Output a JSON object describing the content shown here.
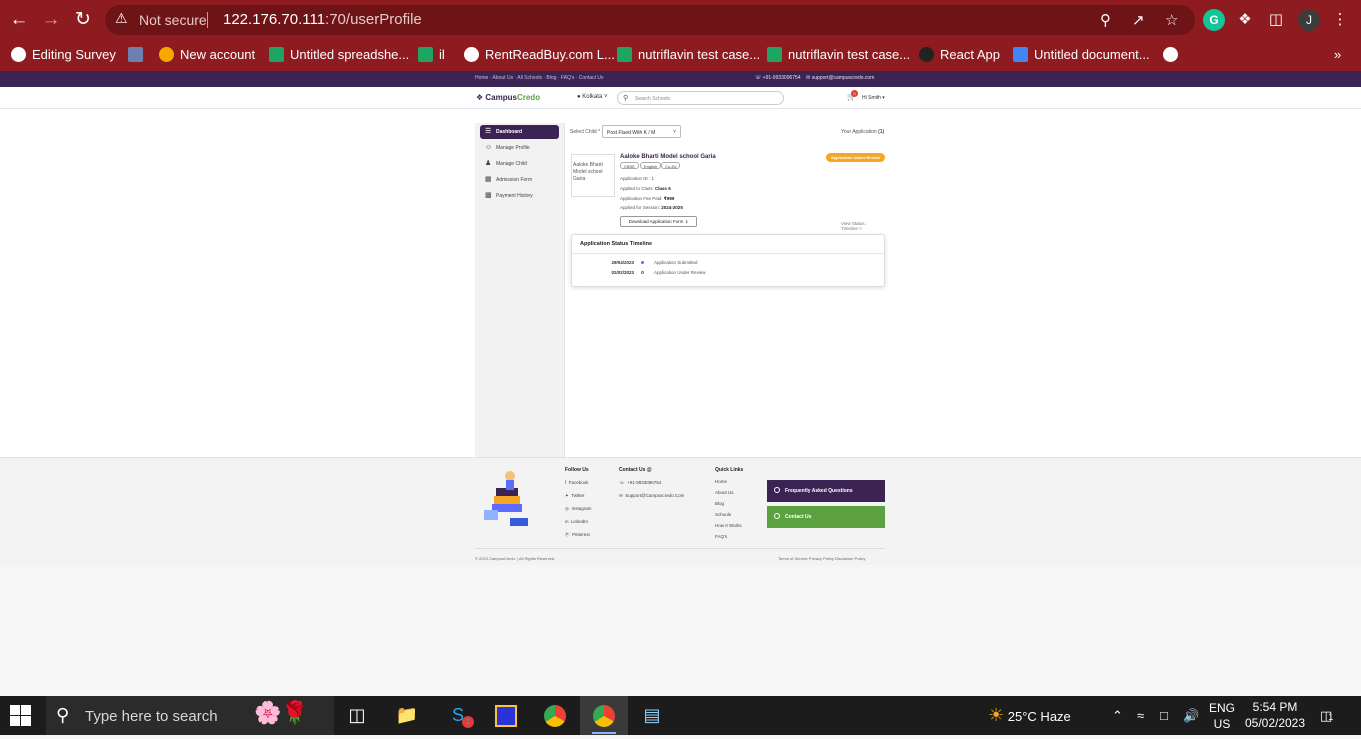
{
  "browser": {
    "not_secure": "Not secure",
    "url_host": "122.176.70.111",
    "url_path": ":70/userProfile",
    "profile_initial": "J"
  },
  "bookmarks": [
    {
      "label": "Editing Survey",
      "icon": "survey-icon"
    },
    {
      "label": "",
      "icon": "tower-icon"
    },
    {
      "label": "New account",
      "icon": "sun-icon"
    },
    {
      "label": "Untitled spreadshe...",
      "icon": "sheets-icon"
    },
    {
      "label": "il",
      "icon": "sheets-icon"
    },
    {
      "label": "RentReadBuy.com L...",
      "icon": "globe-icon"
    },
    {
      "label": "nutriflavin test case...",
      "icon": "sheets-icon"
    },
    {
      "label": "nutriflavin test case...",
      "icon": "sheets-icon"
    },
    {
      "label": "React App",
      "icon": "react-icon"
    },
    {
      "label": "Untitled document...",
      "icon": "docs-icon"
    },
    {
      "label": "",
      "icon": "globe-icon"
    }
  ],
  "site": {
    "breadcrumbs": "Home  ·  About Us  ·  All Schools  ·  Blog  ·  FAQ's  ·  Contact Us",
    "phone": "+91-9933096754",
    "email": "support@campuscredo.com",
    "logo_a": "Campus",
    "logo_b": "Credo",
    "location": "Kolkata",
    "search_placeholder": "Search Schools",
    "cart_count": "0",
    "greeting": "Hi Smith"
  },
  "sidebar": {
    "items": [
      {
        "label": "Dashboard",
        "icon": "dashboard-icon"
      },
      {
        "label": "Manage Profile",
        "icon": "user-icon"
      },
      {
        "label": "Manage Child",
        "icon": "family-icon"
      },
      {
        "label": "Admission Form",
        "icon": "form-icon"
      },
      {
        "label": "Payment History",
        "icon": "wallet-icon"
      }
    ]
  },
  "main": {
    "select_child_label": "Select Child *",
    "select_child_value": "Post Flued With K / M",
    "your_application": "Your Application",
    "your_application_count": "(1)",
    "school_image_alt": "Aaloke Bharti Model school Garia",
    "school_name": "Aaloke Bharti Model school Garia",
    "tags": [
      "CBSE",
      "English",
      "Co-Ed"
    ],
    "status_pill": "Application Under Review",
    "application_id_label": "Application ID :",
    "application_id": "1",
    "applied_class_label": "Applied to Class:",
    "applied_class": "Class 6",
    "fee_label": "Application Fee Paid:",
    "fee": "₹999",
    "session_label": "Applied for Session:",
    "session": "2024-2025",
    "download_button": "Download Application Form",
    "view_status": "View Status : Timeline"
  },
  "timeline": {
    "title": "Application Status Timeline",
    "rows": [
      {
        "date": "29/04/2023",
        "label": "Application Submitted"
      },
      {
        "date": "02/02/2023",
        "label": "Application Under Review"
      }
    ]
  },
  "footer": {
    "follow_title": "Follow Us",
    "follow": [
      "Facebook",
      "Twitter",
      "Instagram",
      "LinkedIn",
      "Pinterest"
    ],
    "contact_title": "Contact Us @",
    "contact_phone": "+91-9933096754",
    "contact_email": "Support@Campuscredo.Com",
    "quick_title": "Quick Links",
    "quick": [
      "Home",
      "About Us",
      "Blog",
      "Schools",
      "How It Works",
      "FAQ's"
    ],
    "faq_button": "Frequently Asked Questions",
    "contact_button": "Contact Us",
    "copyright": "© 2023 CampusCredo. | All Rights Reserved.",
    "legal": "Terms of Service  Privacy Policy  Disclaimer Policy"
  },
  "taskbar": {
    "search_text": "Type here to search",
    "weather": "25°C  Haze",
    "lang_a": "ENG",
    "lang_b": "US",
    "time": "5:54 PM",
    "date": "05/02/2023",
    "notif_count": "1",
    "skype_badge": "1"
  },
  "colors": {
    "chrome_red": "#8e1b1f",
    "brand_purple": "#3b2354",
    "brand_green": "#5ca13f",
    "status_orange": "#f5a623"
  }
}
